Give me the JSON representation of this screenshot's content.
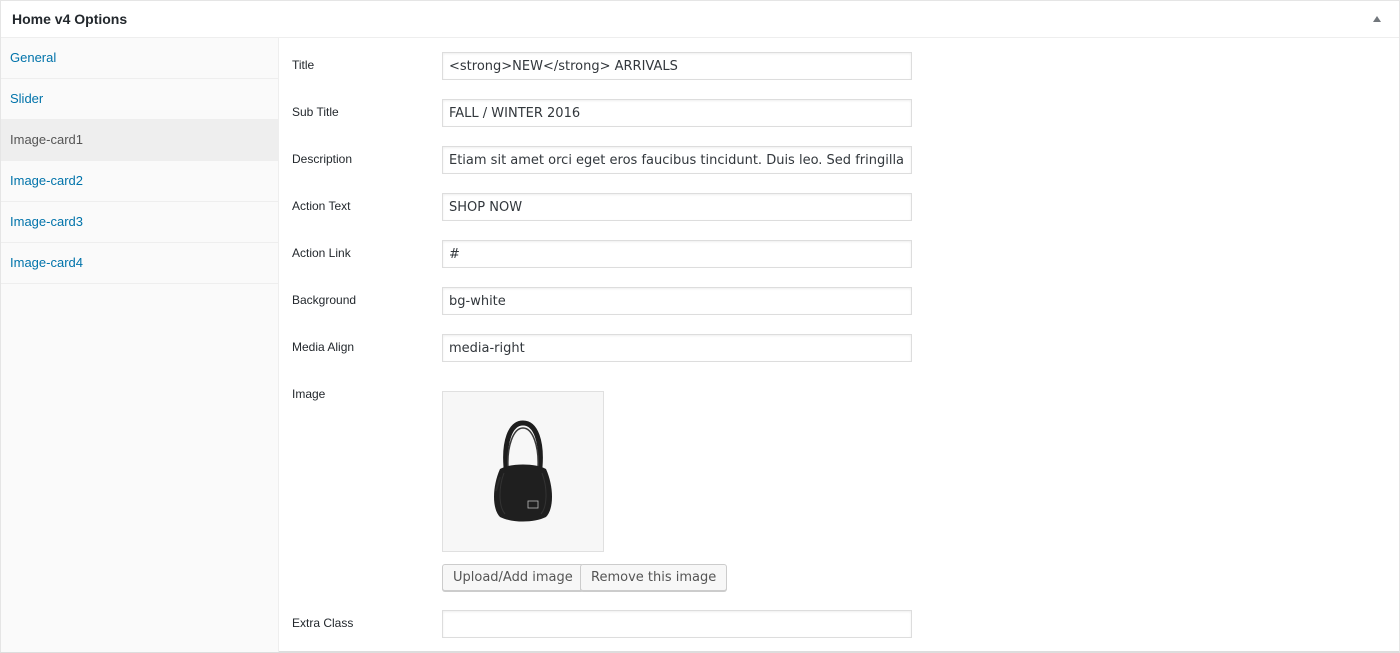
{
  "panel": {
    "title": "Home v4 Options"
  },
  "sidebar": {
    "items": [
      {
        "label": "General"
      },
      {
        "label": "Slider"
      },
      {
        "label": "Image-card1"
      },
      {
        "label": "Image-card2"
      },
      {
        "label": "Image-card3"
      },
      {
        "label": "Image-card4"
      }
    ],
    "active_index": 2
  },
  "fields": {
    "title": {
      "label": "Title",
      "value": "<strong>NEW</strong> ARRIVALS"
    },
    "sub_title": {
      "label": "Sub Title",
      "value": "FALL / WINTER 2016"
    },
    "description": {
      "label": "Description",
      "value": "Etiam sit amet orci eget eros faucibus tincidunt. Duis leo. Sed fringilla mauris sit amet nibh."
    },
    "action_text": {
      "label": "Action Text",
      "value": "SHOP NOW"
    },
    "action_link": {
      "label": "Action Link",
      "value": "#"
    },
    "background": {
      "label": "Background",
      "value": "bg-white"
    },
    "media_align": {
      "label": "Media Align",
      "value": "media-right"
    },
    "image": {
      "label": "Image"
    },
    "extra_class": {
      "label": "Extra Class",
      "value": ""
    }
  },
  "image_buttons": {
    "upload_label": "Upload/Add image",
    "remove_label": "Remove this image"
  },
  "colors": {
    "link": "#0073aa",
    "active_bg": "#eeeeee"
  },
  "icons": {
    "collapse": "triangle-up-icon",
    "image_preview": "handbag-image"
  }
}
